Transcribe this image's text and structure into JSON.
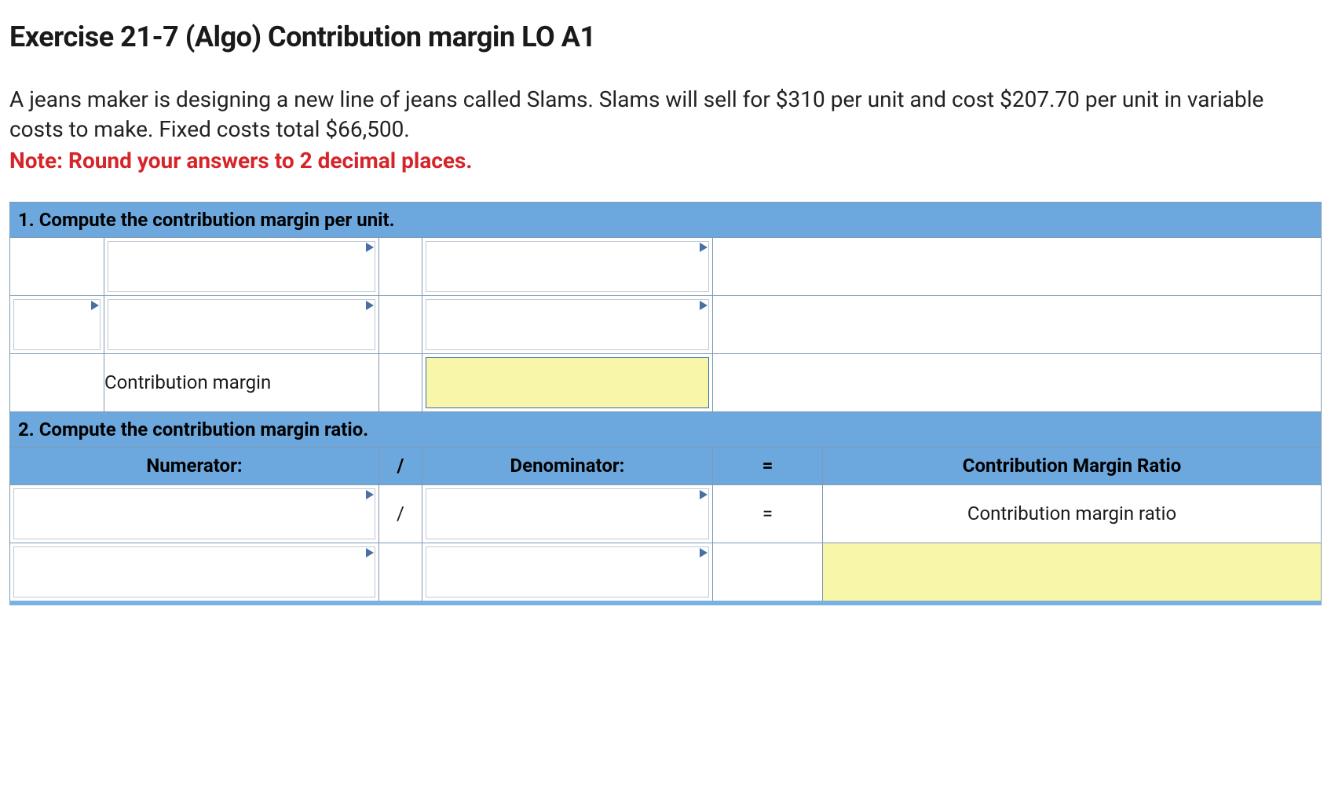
{
  "title": "Exercise 21-7 (Algo) Contribution margin LO A1",
  "description": "A jeans maker is designing a new line of jeans called Slams. Slams will sell for $310 per unit and cost $207.70 per unit in variable costs to make. Fixed costs total $66,500.",
  "note": "Note: Round your answers to 2 decimal places.",
  "section1": {
    "header": "1. Compute the contribution margin per unit.",
    "row3_label": "Contribution margin"
  },
  "section2": {
    "header": "2. Compute the contribution margin ratio.",
    "col_numerator": "Numerator:",
    "col_div": "/",
    "col_denominator": "Denominator:",
    "col_eq": "=",
    "col_result": "Contribution Margin Ratio",
    "row_div": "/",
    "row_eq": "=",
    "row_result_label": "Contribution margin ratio"
  }
}
